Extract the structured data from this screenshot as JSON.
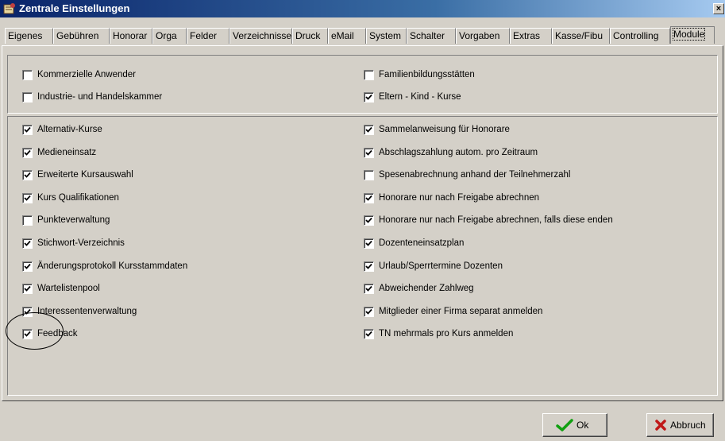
{
  "window": {
    "title": "Zentrale Einstellungen",
    "close_glyph": "×"
  },
  "tabs": [
    {
      "label": "Eigenes"
    },
    {
      "label": "Gebühren"
    },
    {
      "label": "Honorar"
    },
    {
      "label": "Orga"
    },
    {
      "label": "Felder"
    },
    {
      "label": "Verzeichnisse"
    },
    {
      "label": "Druck"
    },
    {
      "label": "eMail"
    },
    {
      "label": "System"
    },
    {
      "label": "Schalter"
    },
    {
      "label": "Vorgaben"
    },
    {
      "label": "Extras"
    },
    {
      "label": "Kasse/Fibu"
    },
    {
      "label": "Controlling"
    },
    {
      "label": "Module"
    }
  ],
  "active_tab": "Module",
  "group1": {
    "left": [
      {
        "label": "Kommerzielle Anwender",
        "checked": false
      },
      {
        "label": "Industrie- und Handelskammer",
        "checked": false
      }
    ],
    "right": [
      {
        "label": "Familienbildungsstätten",
        "checked": false
      },
      {
        "label": "Eltern - Kind - Kurse",
        "checked": true
      }
    ]
  },
  "group2": {
    "left": [
      {
        "label": "Alternativ-Kurse",
        "checked": true
      },
      {
        "label": "Medieneinsatz",
        "checked": true
      },
      {
        "label": "Erweiterte Kursauswahl",
        "checked": true
      },
      {
        "label": "Kurs Qualifikationen",
        "checked": true
      },
      {
        "label": "Punkteverwaltung",
        "checked": false
      },
      {
        "label": "Stichwort-Verzeichnis",
        "checked": true
      },
      {
        "label": "Änderungsprotokoll Kursstammdaten",
        "checked": true
      },
      {
        "label": "Wartelistenpool",
        "checked": true
      },
      {
        "label": "Interessentenverwaltung",
        "checked": true
      },
      {
        "label": "Feedback",
        "checked": true
      }
    ],
    "right": [
      {
        "label": "Sammelanweisung für Honorare",
        "checked": true
      },
      {
        "label": "Abschlagszahlung autom. pro Zeitraum",
        "checked": true
      },
      {
        "label": "Spesenabrechnung anhand der Teilnehmerzahl",
        "checked": false
      },
      {
        "label": "Honorare nur nach Freigabe abrechnen",
        "checked": true
      },
      {
        "label": "Honorare nur nach Freigabe abrechnen, falls diese enden",
        "checked": true
      },
      {
        "label": "Dozenteneinsatzplan",
        "checked": true
      },
      {
        "label": "Urlaub/Sperrtermine Dozenten",
        "checked": true
      },
      {
        "label": "Abweichender Zahlweg",
        "checked": true
      },
      {
        "label": "Mitglieder einer Firma separat anmelden",
        "checked": true
      },
      {
        "label": "TN mehrmals pro Kurs anmelden",
        "checked": true
      }
    ]
  },
  "buttons": {
    "ok": "Ok",
    "cancel": "Abbruch"
  },
  "colors": {
    "titlebar_start": "#0a246a",
    "dialog_bg": "#d4d0c8",
    "ok_icon": "#10a010",
    "cancel_icon": "#c01818"
  },
  "icons": {
    "ok": "checkmark-icon",
    "cancel": "x-icon",
    "app": "app-icon"
  }
}
